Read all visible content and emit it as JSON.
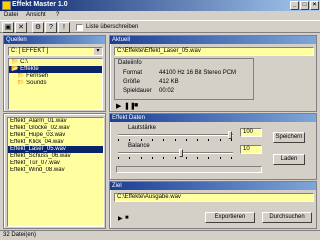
{
  "window": {
    "title": "Effekt Master 1.0"
  },
  "menu": [
    "Datei",
    "Ansicht",
    "?"
  ],
  "toolbar": {
    "checkbox_label": "Liste überschreiben",
    "buttons": [
      "open-folder",
      "delete",
      "settings",
      "help",
      "info"
    ]
  },
  "drives": {
    "title": "Quellen",
    "drive_value": "C: [ EFFEKT ]",
    "folders": [
      "C:\\",
      "Effekte",
      "Fernseh",
      "Sounds"
    ]
  },
  "files": {
    "items": [
      "Effekt_Alarm_01.wav",
      "Effekt_Glocke_02.wav",
      "Effekt_Hupe_03.wav",
      "Effekt_Klick_04.wav",
      "Effekt_Laser_05.wav",
      "Effekt_Schuss_06.wav",
      "Effekt_Tür_07.wav",
      "Effekt_Wind_08.wav"
    ],
    "selected_index": 4
  },
  "current": {
    "title": "Aktuell",
    "file": "C:\\Effekte\\Effekt_Laser_05.wav",
    "info_title": "Dateiinfo",
    "rows": [
      {
        "label": "Format",
        "value": "44100 Hz 16 Bit Stereo PCM"
      },
      {
        "label": "Größe",
        "value": "412 KB"
      },
      {
        "label": "Spieldauer",
        "value": "00:02"
      }
    ]
  },
  "settings": {
    "title": "Effekt Daten",
    "rows": [
      {
        "label": "Lautstärke",
        "value": "100",
        "level": 1.0
      },
      {
        "label": "Balance",
        "value": "10",
        "level": 0.55
      }
    ],
    "buttons": [
      "Speichern",
      "Laden"
    ]
  },
  "output": {
    "title": "Ziel",
    "value": "C:\\Effekte\\Ausgabe.wav",
    "buttons": [
      "Exportieren",
      "Durchsuchen"
    ]
  },
  "status": {
    "text": "32 Datei(en)"
  },
  "colors": {
    "field_bg": "#ffffa0",
    "header_start": "#1c3f94",
    "selection": "#0a246a"
  }
}
